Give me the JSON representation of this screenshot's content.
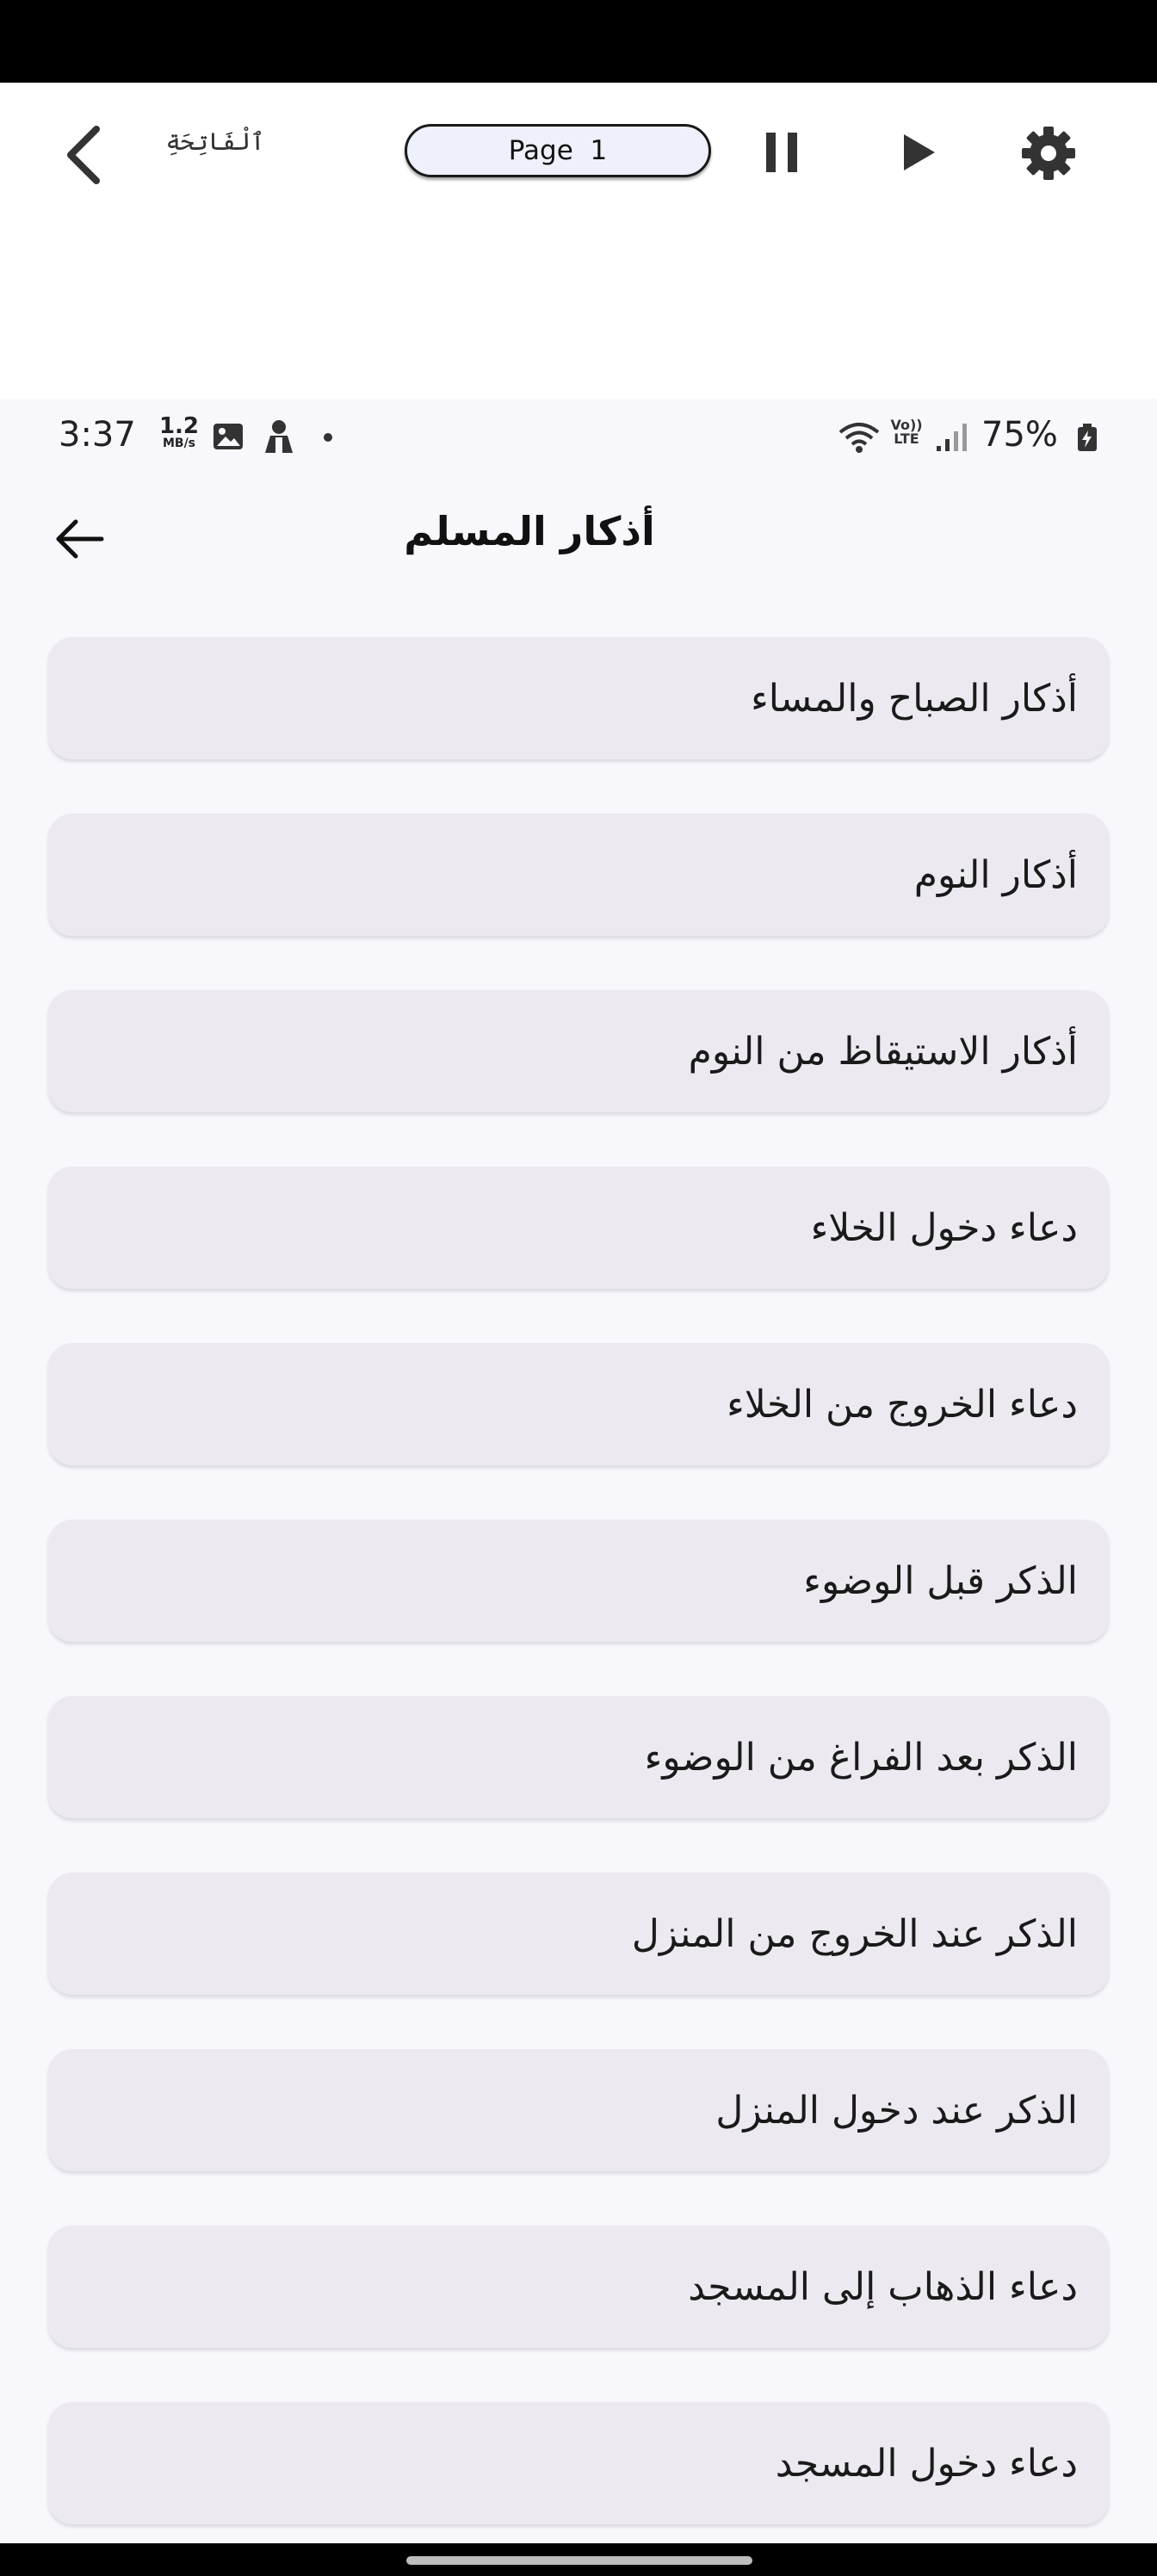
{
  "reader": {
    "surah_name": "ٱلْفَاتِحَةِ",
    "page_label": "Page  1"
  },
  "status_bar": {
    "time": "3:37",
    "speed_value": "1.2",
    "speed_unit": "MB/s",
    "volte_top": "Vo))",
    "volte_bottom": "LTE",
    "battery": "75%"
  },
  "header": {
    "title": "أذكار المسلم"
  },
  "menu": {
    "items": [
      {
        "label": "أذكار الصباح والمساء"
      },
      {
        "label": "أذكار النوم"
      },
      {
        "label": "أذكار الاستيقاظ من النوم"
      },
      {
        "label": "دعاء دخول الخلاء"
      },
      {
        "label": "دعاء الخروج من الخلاء"
      },
      {
        "label": "الذكر قبل الوضوء"
      },
      {
        "label": "الذكر بعد الفراغ من الوضوء"
      },
      {
        "label": "الذكر عند الخروج من المنزل"
      },
      {
        "label": "الذكر عند دخول المنزل"
      },
      {
        "label": "دعاء الذهاب إلى المسجد"
      },
      {
        "label": "دعاء دخول المسجد"
      }
    ]
  },
  "colors": {
    "background": "#f8f7fc",
    "item_background": "#eceaf0",
    "pill_background": "#eef0fb",
    "icon": "#333333"
  },
  "icons": {
    "reader_back": "chevron-left-icon",
    "pause": "pause-icon",
    "play": "play-icon",
    "settings": "gear-icon",
    "header_back": "arrow-left-icon"
  }
}
